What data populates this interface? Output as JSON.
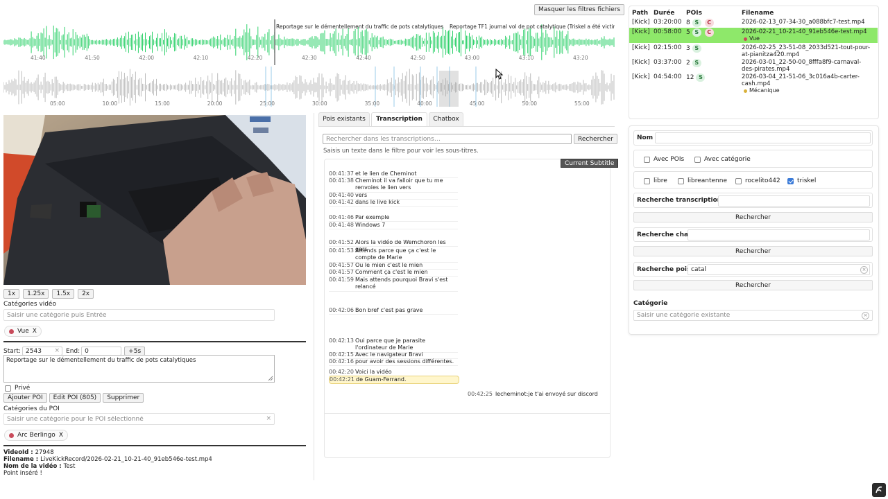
{
  "toolbar": {
    "mask_filters": "Masquer les filtres fichiers"
  },
  "timeline": {
    "top_ticks": [
      "41:40",
      "41:50",
      "42:00",
      "42:10",
      "42:20",
      "42:30",
      "42:40",
      "42:50",
      "43:00",
      "43:10",
      "43:20"
    ],
    "bottom_ticks": [
      "05:00",
      "10:00",
      "15:00",
      "20:00",
      "25:00",
      "30:00",
      "35:00",
      "40:00",
      "45:00",
      "50:00",
      "55:00"
    ],
    "poi_label_1": "Reportage sur le démentellement du traffic de pots catalytiques",
    "poi_label_2": "Reportage TF1 journal vol de pot catalytique (Triskel a été victime 1 sema"
  },
  "speed_buttons": [
    "1x",
    "1.25x",
    "1.5x",
    "2x"
  ],
  "video_categories": {
    "label": "Catégories vidéo",
    "placeholder": "Saisir une catégorie puis Entrée",
    "tag": "Vue",
    "tag_remove": "X"
  },
  "poi_editor": {
    "start_label": "Start:",
    "start_value": "2543",
    "end_label": "End:",
    "end_value": "0",
    "plus5": "+5s",
    "description": "Reportage sur le démentellement du traffic de pots catalytiques",
    "private_label": "Privé",
    "add_button": "Ajouter POI",
    "edit_button": "Edit POI (805)",
    "delete_button": "Supprimer",
    "categories_label": "Catégories du POI",
    "categories_placeholder": "Saisir une catégorie pour le POI sélectionné",
    "tag": "Arc Berlingo",
    "tag_remove": "X"
  },
  "info": {
    "video_id_label": "VideoId",
    "video_id": "27948",
    "filename_label": "Filename",
    "filename": "LiveKickRecord/2026-02-21_10-21-40_91eb546e-test.mp4",
    "video_name_label": "Nom de la vidéo",
    "video_name": "Test",
    "status": "Point inséré !"
  },
  "tabs": [
    "Pois existants",
    "Transcription",
    "Chatbox"
  ],
  "transcription": {
    "search_placeholder": "Rechercher dans les transcriptions…",
    "search_button": "Rechercher",
    "hint": "Saisis un texte dans le filtre pour voir les sous-titres.",
    "current_subtitle_button": "Current Subtitle",
    "rows": [
      {
        "t": "00:41:37",
        "x": "et le lien de Cheminot"
      },
      {
        "t": "00:41:38",
        "x": "Cheminot il va falloir que tu me renvoies le lien vers"
      },
      {
        "t": "00:41:40",
        "x": "vers"
      },
      {
        "t": "00:41:42",
        "x": "dans le live kick"
      },
      {
        "t": "00:41:46",
        "x": "Par exemple"
      },
      {
        "t": "00:41:48",
        "x": "Windows 7"
      },
      {
        "t": "00:41:52",
        "x": "Alors la vidéo de Wemchoron les gars"
      },
      {
        "t": "00:41:53",
        "x": "Attends parce que ça c'est le compte de Marie"
      },
      {
        "t": "00:41:57",
        "x": "Ou le mien c'est le mien"
      },
      {
        "t": "00:41:57",
        "x": "Comment ça c'est le mien"
      },
      {
        "t": "00:41:59",
        "x": "Mais attends pourquoi Bravi s'est relancé"
      },
      {
        "t": "00:42:06",
        "x": "Bon bref c'est pas grave"
      },
      {
        "t": "00:42:13",
        "x": "Oui parce que je parasite l'ordinateur de Marie"
      },
      {
        "t": "00:42:15",
        "x": "Avec le navigateur Bravi"
      },
      {
        "t": "00:42:16",
        "x": "pour avoir des sessions différentes."
      },
      {
        "t": "00:42:20",
        "x": "Voici la vidéo"
      },
      {
        "t": "00:42:21",
        "x": "de Guam-Ferrand."
      }
    ],
    "chat": {
      "t": "00:42:25",
      "user": "lecheminot",
      "msg": "je t'ai envoyé sur discord"
    }
  },
  "file_table": {
    "headers": [
      "Path",
      "Durée",
      "POIs",
      "Filename"
    ],
    "rows": [
      {
        "path": "[Kick]",
        "duration": "03:20:00",
        "pois": "8",
        "badges": [
          "S",
          "C"
        ],
        "filename": "2026-02-13_07-34-30_a088bfc7-test.mp4",
        "category": ""
      },
      {
        "path": "[Kick]",
        "duration": "00:58:00",
        "pois": "5",
        "badges": [
          "S",
          "C"
        ],
        "filename": "2026-02-21_10-21-40_91eb546e-test.mp4",
        "category": "Vue"
      },
      {
        "path": "[Kick]",
        "duration": "02:15:00",
        "pois": "3",
        "badges": [
          "S"
        ],
        "filename": "2026-02-25_23-51-08_2033d521-tout-pour-at-pianitza420.mp4",
        "category": ""
      },
      {
        "path": "[Kick]",
        "duration": "03:37:00",
        "pois": "2",
        "badges": [
          "S"
        ],
        "filename": "2026-03-01_22-50-00_8fffa8f9-carnaval-des-pirates.mp4",
        "category": ""
      },
      {
        "path": "[Kick]",
        "duration": "04:54:00",
        "pois": "12",
        "badges": [
          "S"
        ],
        "filename": "2026-03-04_21-51-06_3c016a4b-carter-cash.mp4",
        "category": "Mécanique"
      }
    ]
  },
  "filters": {
    "name_label": "Nom",
    "with_pois": "Avec POIs",
    "with_category": "Avec catégorie",
    "users": [
      {
        "name": "libre",
        "checked": false
      },
      {
        "name": "libreantenne",
        "checked": false
      },
      {
        "name": "rocelito442",
        "checked": false
      },
      {
        "name": "triskel",
        "checked": true
      }
    ],
    "search_transcriptions_label": "Recherche transcriptions",
    "search_chat_label": "Recherche chat",
    "search_pois_label": "Recherche pois",
    "search_pois_value": "catal",
    "search_button": "Rechercher",
    "category_label": "Catégorie",
    "category_placeholder": "Saisir une catégorie existante"
  },
  "colors": {
    "selected_row": "#8ee86a",
    "waveform_top": "#2fd16b",
    "waveform_bottom": "#bdbdbd",
    "current_sub": "#fff6cc"
  }
}
